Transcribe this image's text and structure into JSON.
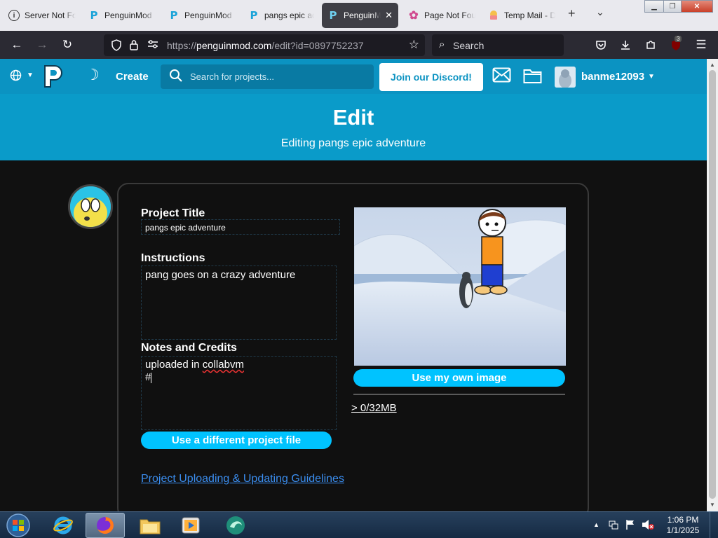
{
  "browser": {
    "tabs": [
      {
        "label": "Server Not Found",
        "icon": "info-icon",
        "active": false
      },
      {
        "label": "PenguinMod",
        "icon": "penguinmod-icon",
        "active": false
      },
      {
        "label": "PenguinMod",
        "icon": "penguinmod-icon",
        "active": false
      },
      {
        "label": "pangs epic adventure",
        "icon": "penguinmod-icon",
        "active": false
      },
      {
        "label": "PenguinMod",
        "icon": "penguinmod-icon",
        "active": true
      },
      {
        "label": "Page Not Found",
        "icon": "flower-icon",
        "active": false
      },
      {
        "label": "Temp Mail - Disposable",
        "icon": "temp-mail-icon",
        "active": false
      }
    ],
    "url_prefix": "https://",
    "url_host": "penguinmod.com",
    "url_path": "/edit?id=0897752237",
    "search_placeholder": "Search",
    "extension_badge": "3"
  },
  "site_nav": {
    "create_label": "Create",
    "search_placeholder": "Search for projects...",
    "discord_label": "Join our Discord!",
    "username": "banme12093"
  },
  "hero": {
    "title": "Edit",
    "subtitle": "Editing pangs epic adventure"
  },
  "form": {
    "title_label": "Project Title",
    "title_value": "pangs epic adventure",
    "instructions_label": "Instructions",
    "instructions_value": "pang goes on a crazy adventure",
    "notes_label": "Notes and Credits",
    "notes_line1_prefix": "uploaded in ",
    "notes_line1_misspelled": "collabvm",
    "notes_line2": "#",
    "project_file_button": "Use a different project file",
    "own_image_button": "Use my own image",
    "size_info": "> 0/32MB",
    "guidelines_link": "Project Uploading & Updating Guidelines"
  },
  "taskbar": {
    "time": "1:06 PM",
    "date": "1/1/2025"
  },
  "colors": {
    "site_blue": "#0b93c2",
    "hero_blue": "#0a9bc9",
    "pill_blue": "#00c3ff",
    "link_blue": "#3b8ef0",
    "page_bg": "#111111"
  }
}
